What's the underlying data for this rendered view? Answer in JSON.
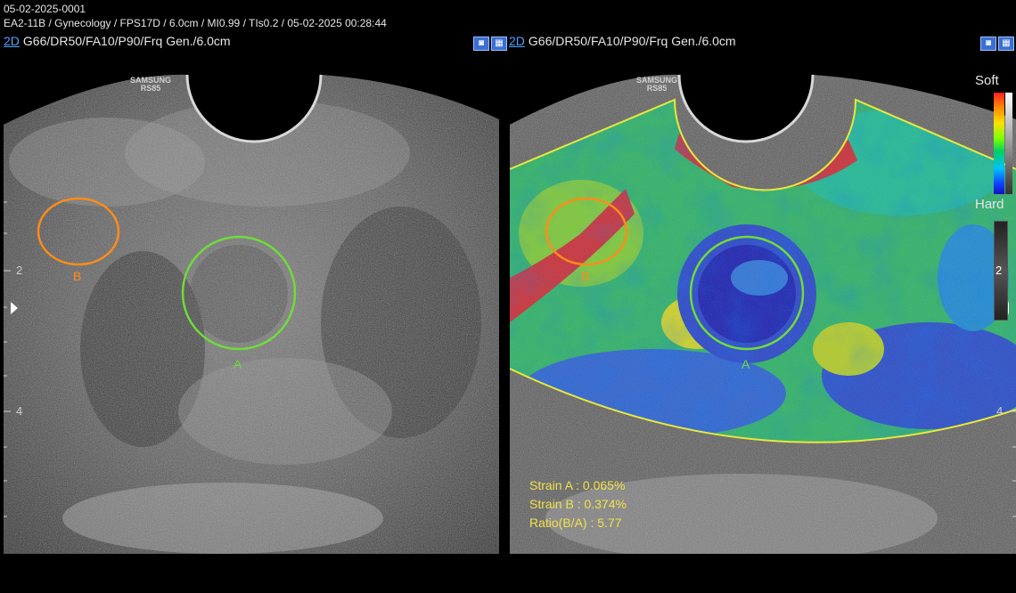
{
  "header": {
    "line1": "05-02-2025-0001",
    "line2": "EA2-11B / Gynecology / FPS17D / 6.0cm / MI0.99 / TIs0.2 / 05-02-2025 00:28:44"
  },
  "left_panel": {
    "mode": "2D",
    "params": "G66/DR50/FA10/P90/Frq Gen./6.0cm",
    "brand_line1": "SAMSUNG",
    "brand_line2": "RS85",
    "depth_marks": [
      "2",
      "4"
    ],
    "roi_a_label": "A",
    "roi_b_label": "B"
  },
  "right_panel": {
    "mode": "2D",
    "params": "G66/DR50/FA10/P90/Frq Gen./6.0cm",
    "brand_line1": "SAMSUNG",
    "brand_line2": "RS85",
    "depth_marks": [
      "4"
    ],
    "roi_a_label": "A",
    "roi_b_label": "B"
  },
  "color_scale": {
    "soft_label": "Soft",
    "hard_label": "Hard",
    "gray_scale_number": "2"
  },
  "measurements": {
    "strain_a": "Strain A : 0.065%",
    "strain_b": "Strain B : 0.374%",
    "ratio": "Ratio(B/A) : 5.77"
  },
  "colors": {
    "roi_a": "#6fdc3a",
    "roi_b": "#ff8c1a",
    "measurement_text": "#f0e14a",
    "elasto_outline": "#e8e83a"
  },
  "icons": [
    "image-mode-icon",
    "measure-mode-icon"
  ]
}
